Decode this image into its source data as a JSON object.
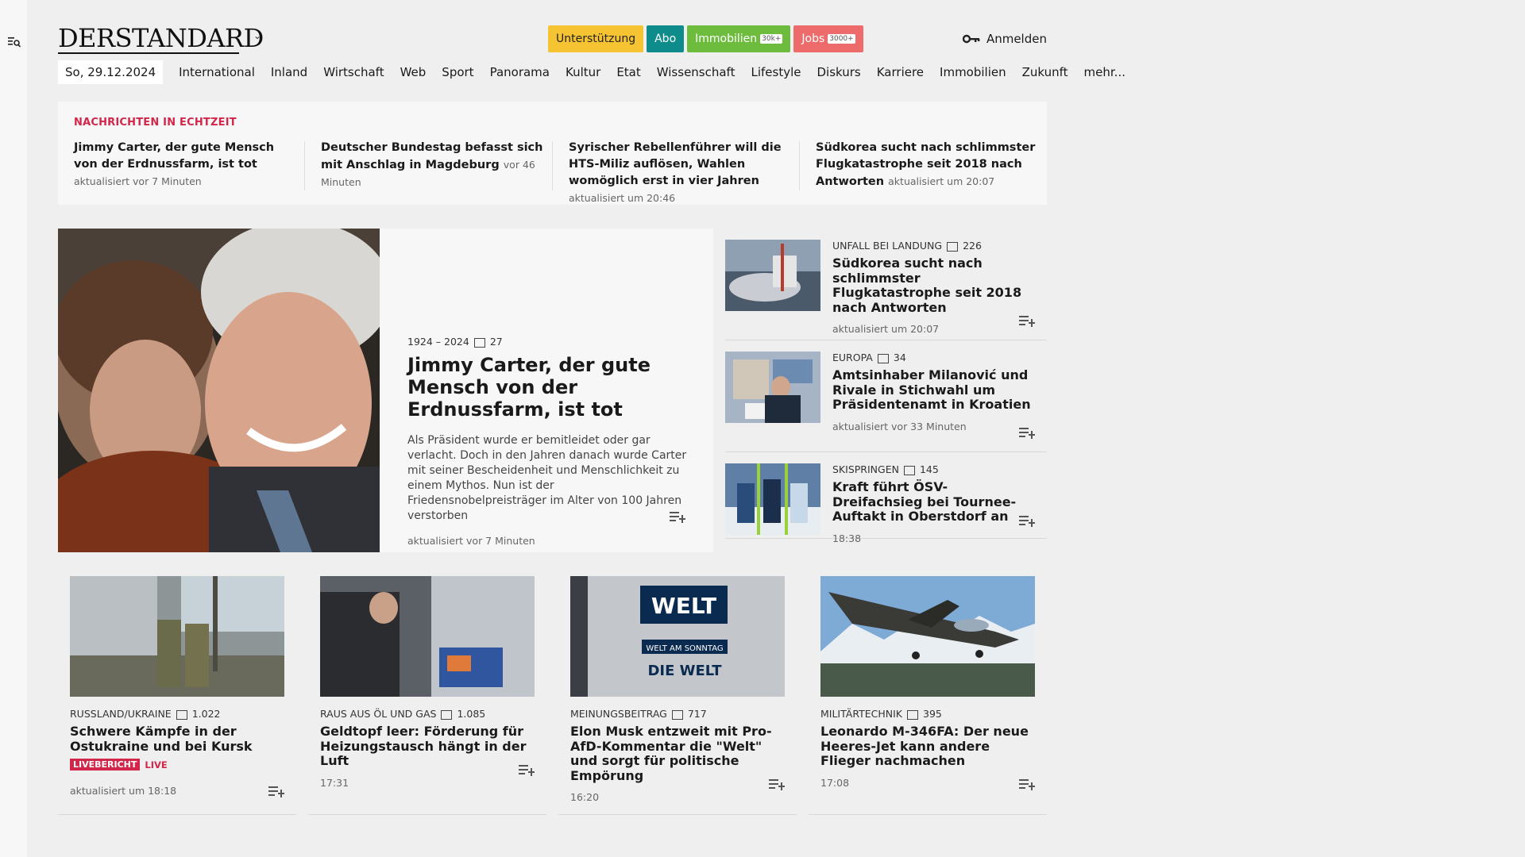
{
  "header": {
    "logo": "DERSTANDARD",
    "badges": [
      {
        "label": "Unterstützung",
        "extra": ""
      },
      {
        "label": "Abo",
        "extra": ""
      },
      {
        "label": "Immobilien",
        "extra": "30k+"
      },
      {
        "label": "Jobs",
        "extra": "3000+"
      }
    ],
    "login": "Anmelden"
  },
  "nav": {
    "date": "So, 29.12.2024",
    "items": [
      "International",
      "Inland",
      "Wirtschaft",
      "Web",
      "Sport",
      "Panorama",
      "Kultur",
      "Etat",
      "Wissenschaft",
      "Lifestyle",
      "Diskurs",
      "Karriere",
      "Immobilien",
      "Zukunft",
      "mehr..."
    ]
  },
  "ticker": {
    "label": "NACHRICHTEN IN ECHTZEIT",
    "items": [
      {
        "title": "Jimmy Carter, der gute Mensch von der Erdnussfarm, ist tot",
        "meta": "aktualisiert vor 7 Minuten"
      },
      {
        "title": "Deutscher Bundestag befasst sich mit Anschlag in Magdeburg",
        "meta": "vor 46 Minuten"
      },
      {
        "title": "Syrischer Rebellenführer will die HTS-Miliz auflösen, Wahlen womöglich erst in vier Jahren",
        "meta": "aktualisiert um 20:46"
      },
      {
        "title": "Südkorea sucht nach schlimmster Flugkatastrophe seit 2018 nach Ant­worten",
        "meta": "aktualisiert um 20:07"
      }
    ]
  },
  "hero": {
    "kicker": "1924 – 2024",
    "comments": "27",
    "title": "Jimmy Carter, der gute Mensch von der Erdnussfarm, ist tot",
    "teaser": "Als Präsident wurde er bemitleidet oder gar verlacht. Doch in den Jahren danach wurde Carter mit seiner Bescheidenheit und Menschlichkeit zu einem Mythos. Nun ist der Friedensnobelpreisträger im Alter von 100 Jahren verstorben",
    "meta": "aktualisiert vor 7 Minuten"
  },
  "side": [
    {
      "kicker": "UNFALL BEI LANDUNG",
      "comments": "226",
      "title": "Südkorea sucht nach schlimmster Flugkatastrophe seit 2018 nach Antworten",
      "meta": "aktualisiert um 20:07"
    },
    {
      "kicker": "EUROPA",
      "comments": "34",
      "title": "Amtsinhaber Milanović und Rivale in Stichwahl um Präsidentenamt in Kroatien",
      "meta": "aktualisiert vor 33 Minuten"
    },
    {
      "kicker": "SKISPRINGEN",
      "comments": "145",
      "title": "Kraft führt ÖSV-Dreifachsieg bei Tournee-Auftakt in Oberstdorf an",
      "meta": "18:38"
    }
  ],
  "cards": [
    {
      "kicker": "RUSSLAND/UKRAINE",
      "comments": "1.022",
      "title": "Schwere Kämpfe in der Ostukraine und bei Kursk",
      "live_badge": "LIVEBERICHT",
      "live": "LIVE",
      "meta": "aktualisiert um 18:18"
    },
    {
      "kicker": "RAUS AUS ÖL UND GAS",
      "comments": "1.085",
      "title": "Geldtopf leer: Förderung für Heizungstausch hängt in der Luft",
      "meta": "17:31"
    },
    {
      "kicker": "MEINUNGSBEITRAG",
      "comments": "717",
      "title": "Elon Musk entzweit mit Pro-AfD-Kommentar die \"Welt\" und sorgt für politische Empörung",
      "meta": "16:20",
      "sign_main": "WELT",
      "sign_sub": "WELT AM SONNTAG",
      "sign_die": "DIE WELT"
    },
    {
      "kicker": "MILITÄRTECHNIK",
      "comments": "395",
      "title": "Leonardo M-346FA: Der neue Heeres-Jet kann andere Flieger nachmachen",
      "meta": "17:08"
    }
  ],
  "colors": {
    "accent_red": "#d3264b",
    "abo_teal": "#0e8c8c",
    "support_yellow": "#f6c332",
    "immo_green": "#6ebc3e",
    "jobs_red": "#ee6b6b"
  }
}
